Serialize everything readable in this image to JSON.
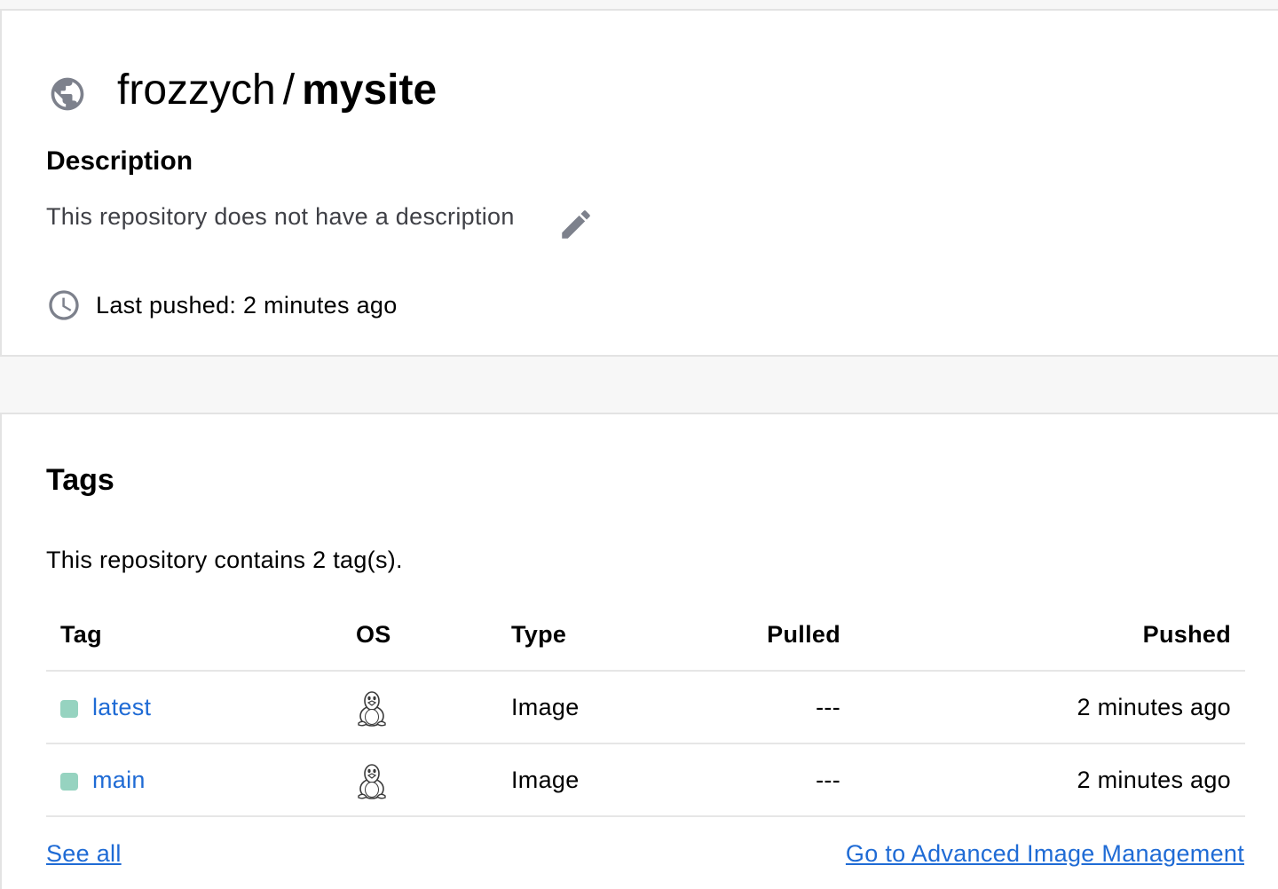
{
  "repo": {
    "namespace": "frozzych",
    "separator": "/",
    "name": "mysite",
    "visibility_icon": "globe-icon"
  },
  "description": {
    "heading": "Description",
    "text": "This repository does not have a description",
    "edit_icon": "pencil-icon"
  },
  "last_pushed": {
    "icon": "clock-icon",
    "text": "Last pushed: 2 minutes ago"
  },
  "tags": {
    "heading": "Tags",
    "count_text": "This repository contains 2 tag(s).",
    "columns": {
      "tag": "Tag",
      "os": "OS",
      "type": "Type",
      "pulled": "Pulled",
      "pushed": "Pushed"
    },
    "rows": [
      {
        "tag": "latest",
        "os_icon": "linux-icon",
        "type": "Image",
        "pulled": "---",
        "pushed": "2 minutes ago"
      },
      {
        "tag": "main",
        "os_icon": "linux-icon",
        "type": "Image",
        "pulled": "---",
        "pushed": "2 minutes ago"
      }
    ],
    "see_all": "See all",
    "advanced_link": "Go to Advanced Image Management"
  },
  "colors": {
    "link": "#1f6bd5",
    "tag_dot": "#96d3c0",
    "icon_gray": "#7d818c"
  }
}
